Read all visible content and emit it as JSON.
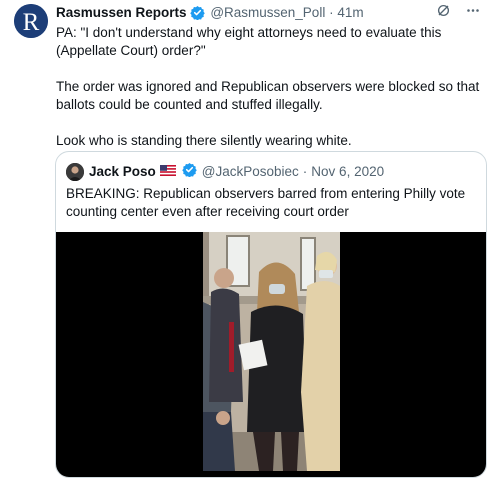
{
  "tweet": {
    "author_name": "Rasmussen Reports",
    "handle": "@Rasmussen_Poll",
    "separator": "·",
    "time": "41m",
    "paragraphs": [
      "PA: \"I don't understand why eight attorneys need to evaluate this (Appellate Court) order?\"",
      "The order was ignored and Republican observers were blocked so that ballots could be counted and stuffed illegally.",
      "Look who is standing there silently wearing white."
    ],
    "avatar_letter": "R",
    "icons": [
      "verified-badge-icon",
      "grok-icon",
      "more-icon"
    ]
  },
  "quote": {
    "author_name": "Jack Poso",
    "handle": "@JackPosobiec",
    "separator": "·",
    "date": "Nov 6, 2020",
    "text": "BREAKING: Republican observers barred from entering Philly vote counting center even after receiving court order",
    "icons": [
      "us-flag-icon",
      "verified-badge-icon"
    ]
  },
  "colors": {
    "verified": "#1d9bf0",
    "secondary_text": "#536471",
    "border": "#cfd9de",
    "avatar_bg": "#1d3e78"
  }
}
